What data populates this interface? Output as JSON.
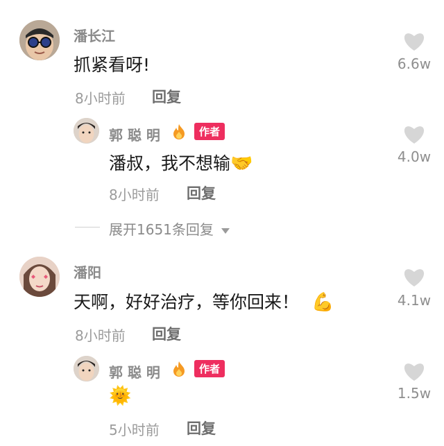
{
  "comments": [
    {
      "author": "潘长江",
      "text": "抓紧看呀!",
      "time": "8小时前",
      "reply_label": "回复",
      "likes": "6.6w",
      "avatar_icon": "sunglasses-man-avatar",
      "reply": {
        "author": "郭 聪 明",
        "badge": "作者",
        "text": "潘叔，我不想输",
        "emoji": "🤝",
        "time": "8小时前",
        "reply_label": "回复",
        "likes": "4.0w"
      },
      "expand_label": "展开1651条回复"
    },
    {
      "author": "潘阳",
      "text": "天啊，好好治疗，等你回来！",
      "emoji": "💪",
      "time": "8小时前",
      "reply_label": "回复",
      "likes": "4.1w",
      "avatar_icon": "woman-avatar",
      "reply": {
        "author": "郭 聪 明",
        "badge": "作者",
        "text": "",
        "emoji": "🌞",
        "time": "5小时前",
        "reply_label": "回复",
        "likes": "1.5w"
      }
    }
  ],
  "colors": {
    "badge": "#ee2e5f",
    "heart": "#d6d6d6",
    "fire": "#f59a23"
  }
}
